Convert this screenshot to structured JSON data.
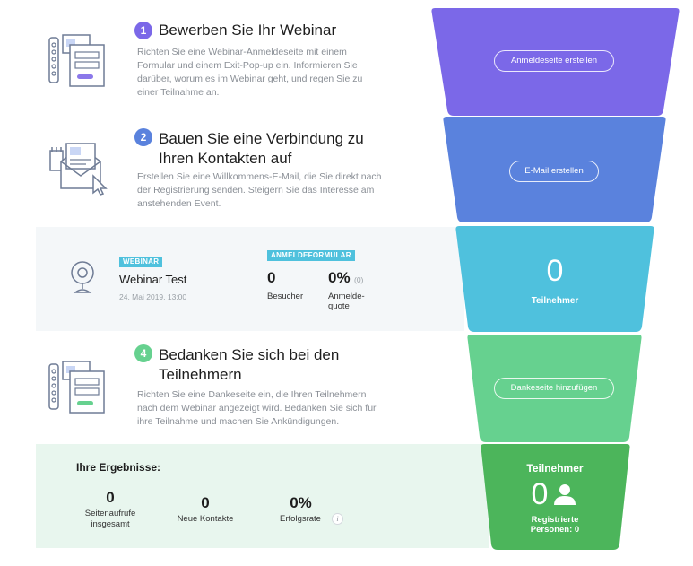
{
  "steps": [
    {
      "number": "1",
      "title": "Bewerben Sie Ihr Webinar",
      "desc": "Richten Sie eine Webinar-Anmeldeseite mit einem Formular und einem Exit-Pop-up ein. Informieren Sie darüber, worum es im Webinar geht, und regen Sie zu einer Teilnahme an.",
      "button": "Anmeldeseite erstellen",
      "color": "#7b68e8"
    },
    {
      "number": "2",
      "title": "Bauen Sie eine Verbindung zu Ihren Kontakten auf",
      "desc": "Erstellen Sie eine Willkommens-E-Mail, die Sie direkt nach der Registrierung senden. Steigern Sie das Interesse am anstehenden Event.",
      "button": "E-Mail erstellen",
      "color": "#5a82dd"
    },
    {
      "number": "4",
      "title": "Bedanken Sie sich bei den Teilnehmern",
      "desc": "Richten Sie eine Dankeseite ein, die Ihren Teilnehmern nach dem Webinar angezeigt wird. Bedanken Sie sich für ihre Teilnahme und machen Sie Ankündigungen.",
      "button": "Dankeseite hinzufügen",
      "color": "#66d18f"
    }
  ],
  "webinar": {
    "tag": "WEBINAR",
    "name": "Webinar Test",
    "date": "24. Mai 2019, 13:00",
    "form_tag": "ANMELDEFORMULAR",
    "visitors_value": "0",
    "visitors_label": "Besucher",
    "rate_value": "0%",
    "rate_small": "(0)",
    "rate_label_1": "Anmelde-",
    "rate_label_2": "quote",
    "participants_value": "0",
    "participants_label": "Teilnehmer",
    "color": "#4fc1dd"
  },
  "results": {
    "title": "Ihre Ergebnisse:",
    "page_views_value": "0",
    "page_views_label_1": "Seitenaufrufe",
    "page_views_label_2": "insgesamt",
    "new_contacts_value": "0",
    "new_contacts_label": "Neue Kontakte",
    "success_value": "0%",
    "success_label": "Erfolgsrate",
    "info_icon": "i",
    "final_title": "Teilnehmer",
    "final_value": "0",
    "final_label_1": "Registrierte",
    "final_label_2": "Personen: 0",
    "color": "#4cb55b"
  }
}
